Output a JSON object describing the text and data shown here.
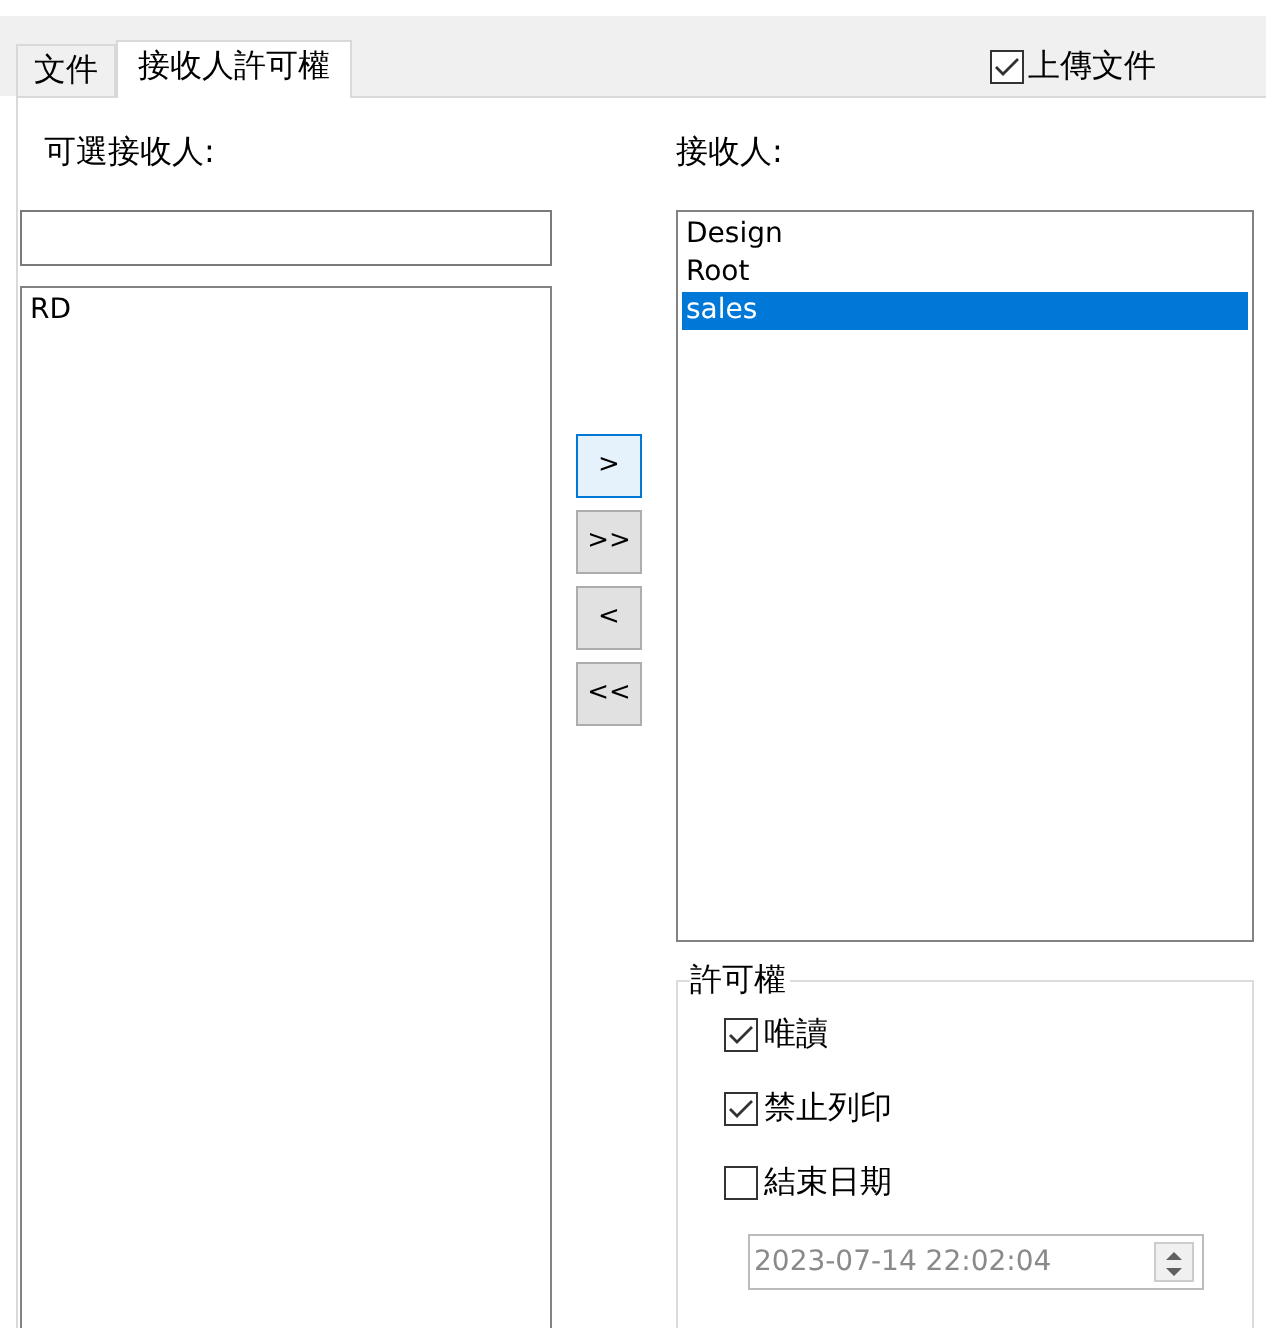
{
  "tabs": [
    {
      "label": "文件",
      "selected": false
    },
    {
      "label": "接收人許可權",
      "selected": true
    }
  ],
  "upload_option": {
    "label": "上傳文件",
    "checked": true
  },
  "available": {
    "label": "可選接收人:",
    "items": [
      {
        "label": "RD",
        "selected": false
      }
    ]
  },
  "transfer_buttons": [
    {
      "label": ">",
      "focused": true
    },
    {
      "label": ">>",
      "focused": false
    },
    {
      "label": "<",
      "focused": false
    },
    {
      "label": "<<",
      "focused": false
    }
  ],
  "recipients": {
    "label": "接收人:",
    "items": [
      {
        "label": "Design",
        "selected": false
      },
      {
        "label": "Root",
        "selected": false
      },
      {
        "label": "sales",
        "selected": true
      }
    ]
  },
  "permissions": {
    "title": "許可權",
    "options": [
      {
        "label": "唯讀",
        "checked": true
      },
      {
        "label": "禁止列印",
        "checked": true
      },
      {
        "label": "結束日期",
        "checked": false
      }
    ],
    "end_date": {
      "value": "2023-07-14 22:02:04",
      "disabled": true
    }
  }
}
